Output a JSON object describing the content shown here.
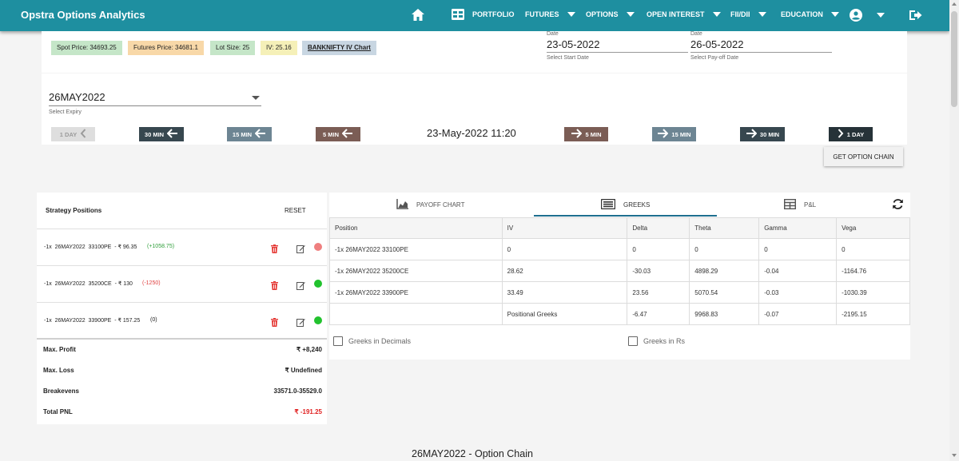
{
  "app": {
    "title": "Opstra Options Analytics"
  },
  "nav": {
    "portfolio": "PORTFOLIO",
    "futures": "FUTURES",
    "options": "OPTIONS",
    "open_interest": "OPEN INTEREST",
    "fii_dii": "FII/DII",
    "education": "EDUCATION"
  },
  "chips": {
    "spot": "Spot Price: 34693.25",
    "futures": "Futures Price: 34681.1",
    "lot": "Lot Size: 25",
    "iv": "IV: 25.16",
    "ivchart": "BANKNIFTY IV Chart"
  },
  "dates": {
    "start": {
      "label": "Date",
      "value": "23-05-2022",
      "hint": "Select Start Date"
    },
    "payoff": {
      "label": "Date",
      "value": "26-05-2022",
      "hint": "Select Pay-off Date"
    }
  },
  "expiry": {
    "value": "26MAY2022",
    "hint": "Select Expiry"
  },
  "time_controls": {
    "back_1day": "1 DAY",
    "back_30min": "30 MIN",
    "back_15min": "15 MIN",
    "back_5min": "5 MIN",
    "datetime": "23-May-2022 11:20",
    "fwd_5min": "5 MIN",
    "fwd_15min": "15 MIN",
    "fwd_30min": "30 MIN",
    "fwd_1day": "1 DAY"
  },
  "get_chain": "GET OPTION CHAIN",
  "strategy": {
    "title": "Strategy Positions",
    "reset": "RESET",
    "positions": [
      {
        "desc": "-1x  26MAY2022  33100PE  - ₹ 96.35",
        "pnl": "(+1058.75)",
        "pnl_color": "#2e9e3a",
        "dot": "#ef7f7f"
      },
      {
        "desc": "-1x  26MAY2022  35200CE  - ₹ 130",
        "pnl": "(-1250)",
        "pnl_color": "#e04040",
        "dot": "#22c22e"
      },
      {
        "desc": "-1x  26MAY2022  33900PE  - ₹ 157.25",
        "pnl": "(0)",
        "pnl_color": "#222222",
        "dot": "#22c22e"
      }
    ],
    "summary": [
      {
        "label": "Max. Profit",
        "value": "₹ +8,240",
        "color": "#222222"
      },
      {
        "label": "Max. Loss",
        "value": "₹ Undefined",
        "color": "#222222"
      },
      {
        "label": "Breakevens",
        "value": "33571.0-35529.0",
        "color": "#222222"
      },
      {
        "label": "Total PNL",
        "value": "₹ -191.25",
        "color": "#e02020"
      }
    ]
  },
  "tabs": {
    "payoff": "PAYOFF CHART",
    "greeks": "GREEKS",
    "pl": "P&L"
  },
  "greeks_table": {
    "headers": [
      "Position",
      "IV",
      "Delta",
      "Theta",
      "Gamma",
      "Vega"
    ],
    "rows": [
      [
        "-1x 26MAY2022 33100PE",
        "0",
        "0",
        "0",
        "0",
        "0"
      ],
      [
        "-1x 26MAY2022 35200CE",
        "28.62",
        "-30.03",
        "4898.29",
        "-0.04",
        "-1164.76"
      ],
      [
        "-1x 26MAY2022 33900PE",
        "33.49",
        "23.56",
        "5070.54",
        "-0.03",
        "-1030.39"
      ],
      [
        "",
        "Positional Greeks",
        "-6.47",
        "9968.83",
        "-0.07",
        "-2195.15"
      ]
    ]
  },
  "checkboxes": {
    "decimals": "Greeks in Decimals",
    "rs": "Greeks in Rs"
  },
  "chain_title": "26MAY2022 - Option Chain"
}
